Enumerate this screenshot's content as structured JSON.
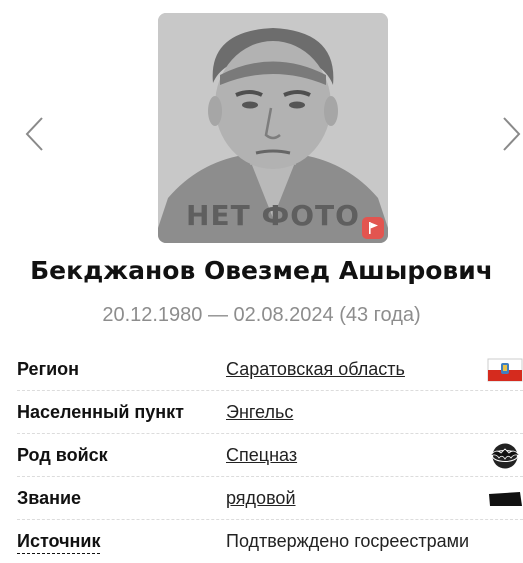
{
  "profile": {
    "photo_placeholder_text": "НЕТ ФОТО",
    "name": "Бекджанов Овезмед Ашырович",
    "dates": "20.12.1980 — 02.08.2024 (43 года)"
  },
  "details": [
    {
      "label": "Регион",
      "value": "Саратовская область",
      "icon": "region-flag-icon"
    },
    {
      "label": "Населенный пункт",
      "value": "Энгельс"
    },
    {
      "label": "Род войск",
      "value": "Спецназ",
      "icon": "special-forces-emblem-icon"
    },
    {
      "label": "Звание",
      "value": "рядовой",
      "icon": "rank-insignia-icon"
    },
    {
      "label": "Источник",
      "value": "Подтверждено госреестрами"
    }
  ],
  "colors": {
    "badge_red": "#e25550",
    "date_gray": "#8d8d8d",
    "placeholder_gray": "#5f5f5f"
  }
}
